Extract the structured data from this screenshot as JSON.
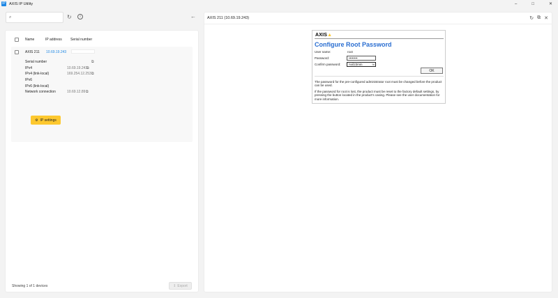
{
  "app": {
    "title": "AXIS IP Utility",
    "icon_letter": "IP",
    "min_glyph": "–",
    "max_glyph": "□",
    "close_glyph": "✕"
  },
  "toolbar": {
    "search_placeholder": "",
    "search_glyph": "⌕",
    "refresh_glyph": "↻",
    "info_glyph": "i",
    "back_glyph": "←"
  },
  "table": {
    "headers": {
      "name": "Name",
      "ip": "IP address",
      "serial": "Serial number"
    }
  },
  "device": {
    "name": "AXIS 211",
    "ip": "10.69.19.243",
    "details": [
      {
        "label": "Serial number",
        "value": ""
      },
      {
        "label": "IPv4",
        "value": "10.69.19.243"
      },
      {
        "label": "IPv4 (link-local)",
        "value": "169.254.12.253"
      },
      {
        "label": "IPv6",
        "value": ""
      },
      {
        "label": "IPv6 (link-local)",
        "value": ""
      },
      {
        "label": "Network connection",
        "value": "10.69.12.89"
      }
    ],
    "ip_settings_label": "IP settings",
    "gear_glyph": "⚙",
    "copy_glyph": "⧉"
  },
  "footer": {
    "showing_text": "Showing 1 of 1 devices",
    "export_label": "Export",
    "export_glyph": "↥"
  },
  "right_panel": {
    "title": "AXIS 211 (10.69.19.243)",
    "refresh_glyph": "↻",
    "open_glyph": "⧉",
    "close_glyph": "✕"
  },
  "camera_page": {
    "logo_text": "AXIS",
    "logo_mark": "▲",
    "heading": "Configure Root Password",
    "user_name_label": "User name:",
    "user_name_value": "root",
    "password_label": "Password:",
    "password_value": "••••••••",
    "confirm_label": "Confirm password:",
    "confirm_value": "Axil23min",
    "show_toggle": "%",
    "ok_label": "OK",
    "note_1": "The password for the pre-configured administrator root must be changed before the product can be used.",
    "note_2": "If the password for root is lost, the product must be reset to the factory default settings, by pressing the button located in the product's casing. Please see the user documentation for more information."
  }
}
